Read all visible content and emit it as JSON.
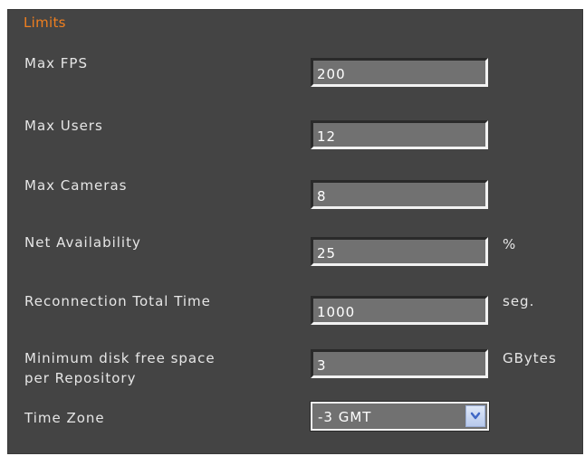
{
  "section": {
    "title": "Limits"
  },
  "fields": {
    "max_fps": {
      "label": "Max FPS",
      "value": "200"
    },
    "max_users": {
      "label": "Max Users",
      "value": "12"
    },
    "max_cameras": {
      "label": "Max Cameras",
      "value": "8"
    },
    "net_availability": {
      "label": "Net Availability",
      "value": "25",
      "unit": "%"
    },
    "reconnection_total_time": {
      "label": "Reconnection Total Time",
      "value": "1000",
      "unit": "seg."
    },
    "min_disk_free_space": {
      "label_line1": "Minimum disk free space",
      "label_line2": "per Repository",
      "value": "3",
      "unit": "GBytes"
    },
    "time_zone": {
      "label": "Time Zone",
      "value": "-3 GMT",
      "icon": "chevron-down-icon"
    }
  },
  "colors": {
    "panel_background": "#444444",
    "title_accent": "#f07f1f",
    "label_text": "#e6e6e6",
    "field_background": "#717171",
    "dropdown_button": "#c7d6f2",
    "dropdown_arrow": "#3f67c5"
  }
}
